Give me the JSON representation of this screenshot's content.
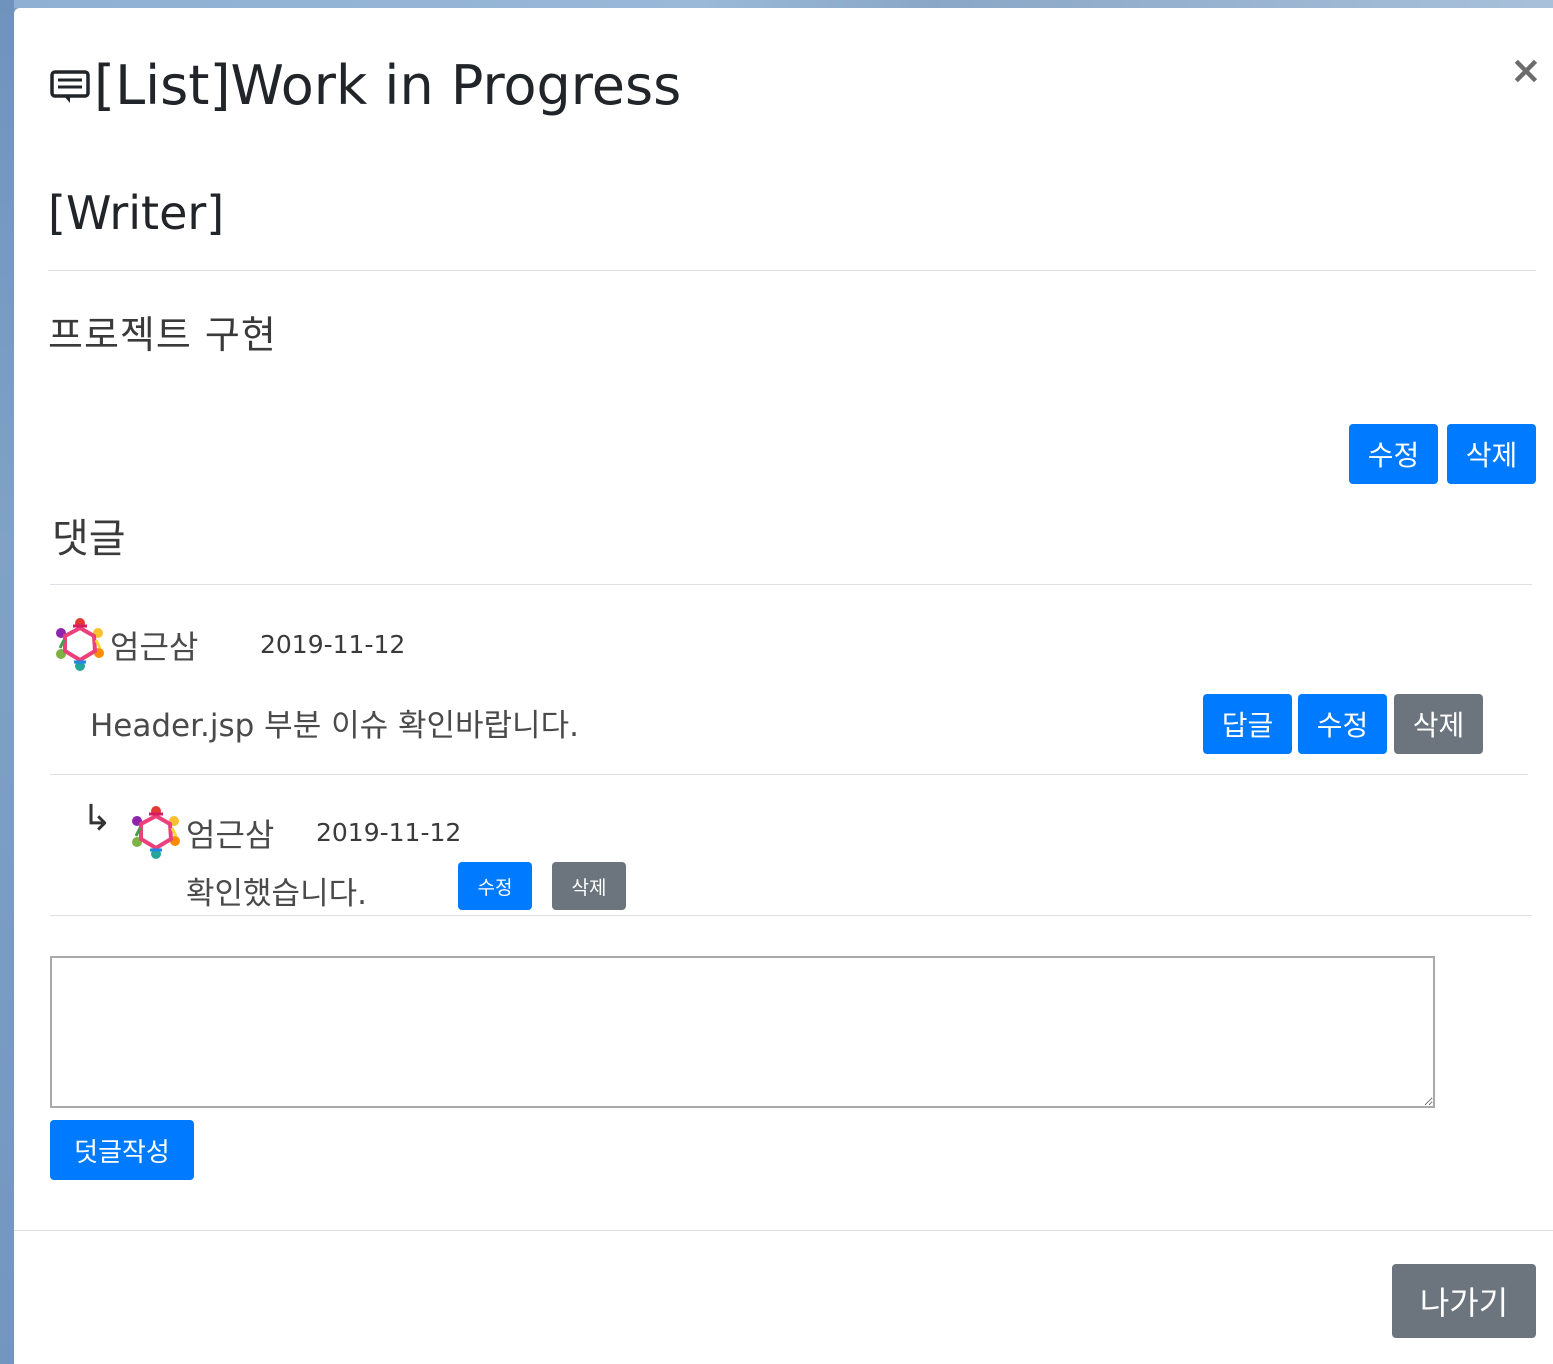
{
  "modal": {
    "title": "[List]Work in Progress",
    "close_label": "×",
    "writer_label": "[Writer]",
    "content": "프로젝트 구현",
    "edit_label": "수정",
    "delete_label": "삭제"
  },
  "comments": {
    "section_title": "댓글",
    "items": [
      {
        "author": "엄근삼",
        "date": "2019-11-12",
        "text": "Header.jsp 부분 이슈 확인바랍니다.",
        "reply_label": "답글",
        "edit_label": "수정",
        "delete_label": "삭제"
      }
    ],
    "replies": [
      {
        "arrow": "↳",
        "author": "엄근삼",
        "date": "2019-11-12",
        "text": "확인했습니다.",
        "edit_label": "수정",
        "delete_label": "삭제"
      }
    ]
  },
  "comment_form": {
    "value": "",
    "placeholder": "",
    "submit_label": "덧글작성"
  },
  "footer": {
    "exit_label": "나가기"
  },
  "colors": {
    "primary": "#007bff",
    "secondary": "#6c757d"
  }
}
